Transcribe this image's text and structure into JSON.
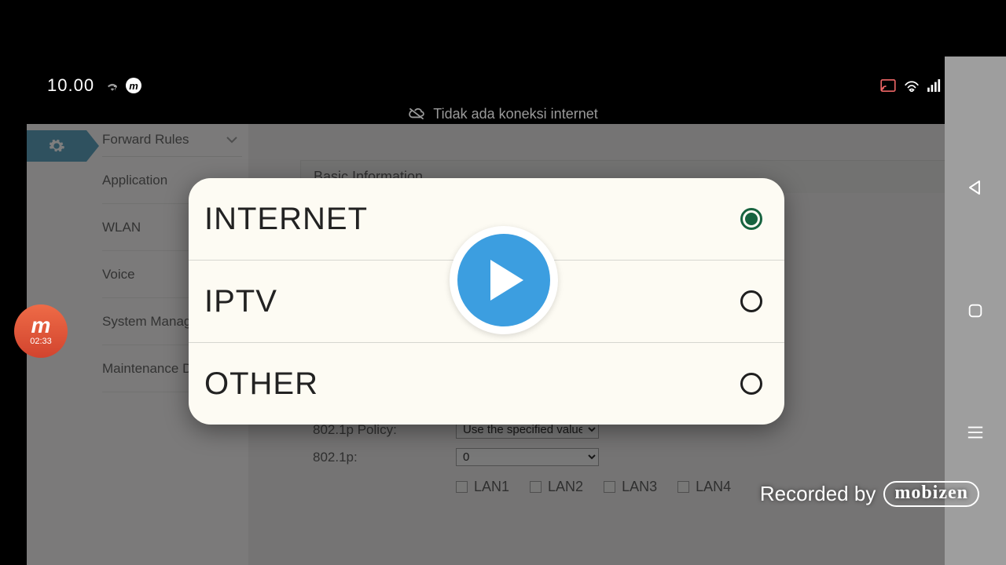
{
  "status": {
    "time": "10.00"
  },
  "banner": {
    "no_internet": "Tidak ada koneksi internet"
  },
  "sidebar": {
    "items": [
      {
        "label": "Forward Rules"
      },
      {
        "label": "Application"
      },
      {
        "label": "WLAN"
      },
      {
        "label": "Voice"
      },
      {
        "label": "System Management"
      },
      {
        "label": "Maintenance Diagnose"
      }
    ]
  },
  "main": {
    "section_title": "Basic Information",
    "rows": {
      "policy_label": "802.1p Policy:",
      "policy_value": "Use the specified value",
      "p_label": "802.1p:",
      "p_value": "0"
    },
    "lans": [
      "LAN1",
      "LAN2",
      "LAN3",
      "LAN4"
    ]
  },
  "dialog": {
    "options": [
      {
        "label": "INTERNET",
        "selected": true
      },
      {
        "label": "IPTV",
        "selected": false
      },
      {
        "label": "OTHER",
        "selected": false
      }
    ]
  },
  "recorder": {
    "time": "02:33"
  },
  "watermark": {
    "prefix": "Recorded by",
    "brand": "mobizen"
  }
}
